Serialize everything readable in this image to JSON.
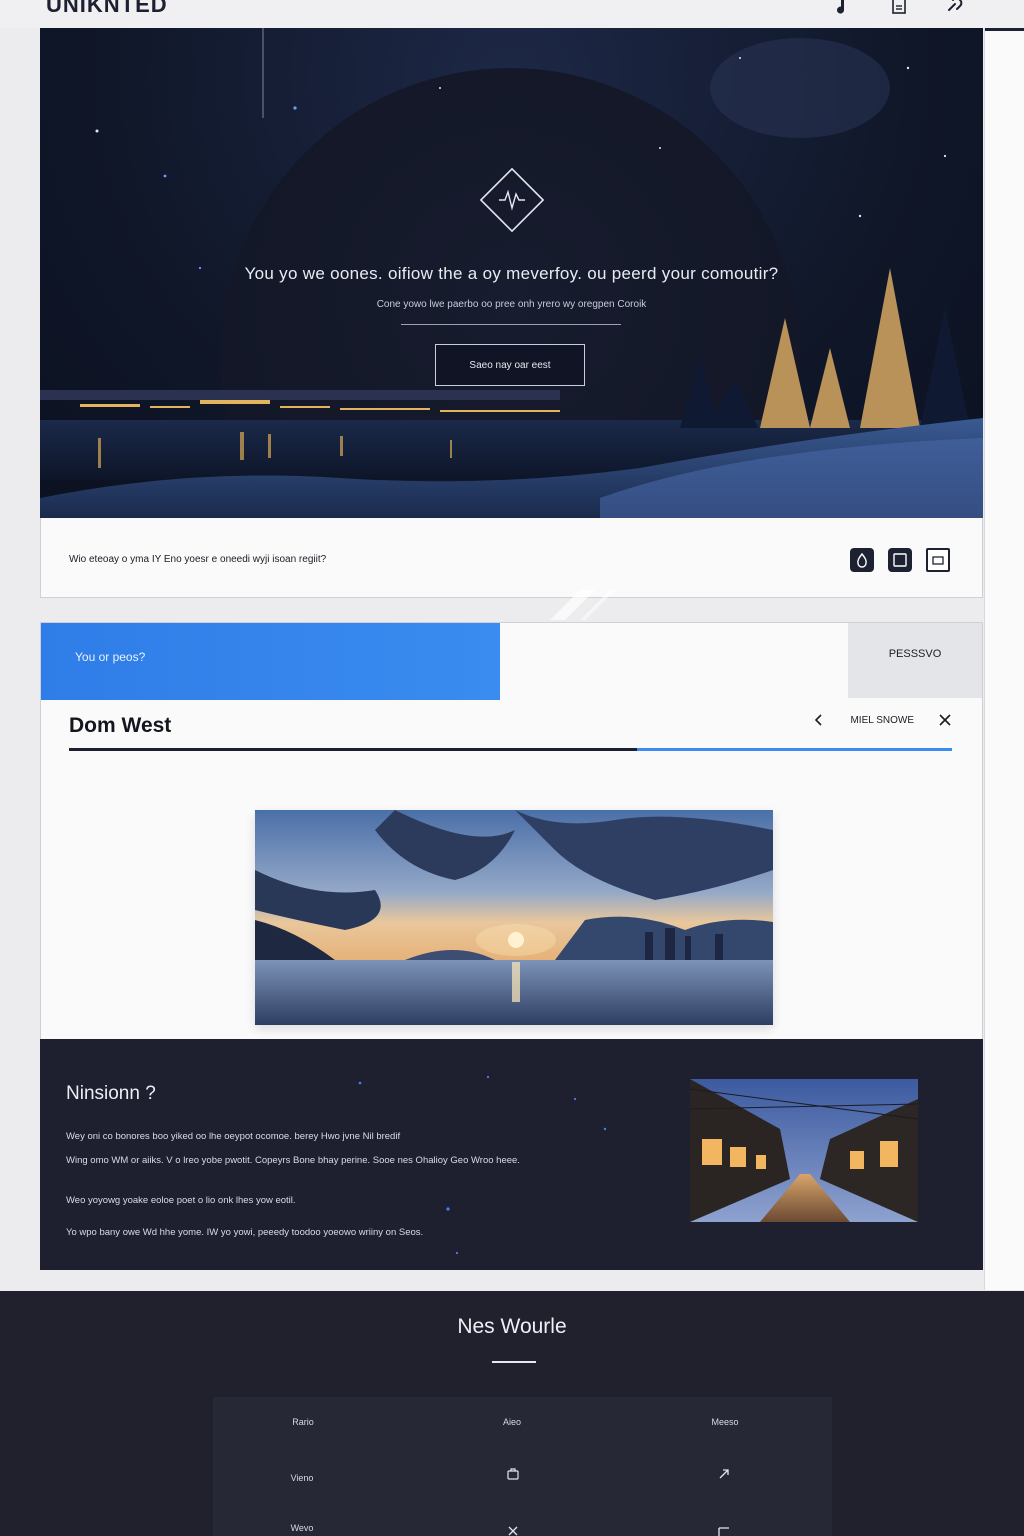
{
  "header": {
    "brand": "UNIKNTED",
    "icons": [
      "music-note-icon",
      "document-icon",
      "link-icon"
    ]
  },
  "hero": {
    "title": "You yo we oones. oifiow the a oy meverfoy. ou peerd your comoutir?",
    "subtitle": "Cone yowo lwe paerbo oo pree onh yrero wy oregpen Coroik",
    "button_label": "Saeo nay oar eest"
  },
  "info_bar": {
    "text": "Wio eteoay o yma IY Eno yoesr e oneedi wyji isoan regiit?",
    "icons": [
      "drop-icon",
      "window-icon",
      "inbox-icon"
    ]
  },
  "card": {
    "banner_text": "You or peos?",
    "side_label": "PESSSVO",
    "title": "Dom West",
    "nav_label": "MIEL SNOWE",
    "colors": {
      "accent": "#3a8cf0",
      "dark": "#1d2030"
    }
  },
  "dark_section": {
    "title": "Ninsionn ?",
    "paragraphs": [
      "Wey oni co bonores boo yiked oo lhe oeypot ocomoe. berey Hwo jvne Nil bredif",
      "Wing omo WM or aiiks. V o lreo yobe pwotit. Copeyrs Bone bhay perine. Sooe nes Ohalioy Geo Wroo heee.",
      "Weo yoyowg yoake eoloe poet o lio onk lhes yow eotil.",
      "Yo wpo bany owe Wd hhe yome. IW yo yowi, peeedy toodoo yoeowo wriiny on Seos."
    ]
  },
  "footer": {
    "title": "Nes Wourle",
    "columns": [
      "Rario",
      "Aieo",
      "Meeso"
    ],
    "rows": [
      {
        "label": "Vieno",
        "col2_icon": "bag-icon",
        "col3_icon": "arrow-icon"
      },
      {
        "label": "Wevo",
        "col2_icon": "close-icon",
        "col3_icon": "corner-icon"
      }
    ]
  }
}
